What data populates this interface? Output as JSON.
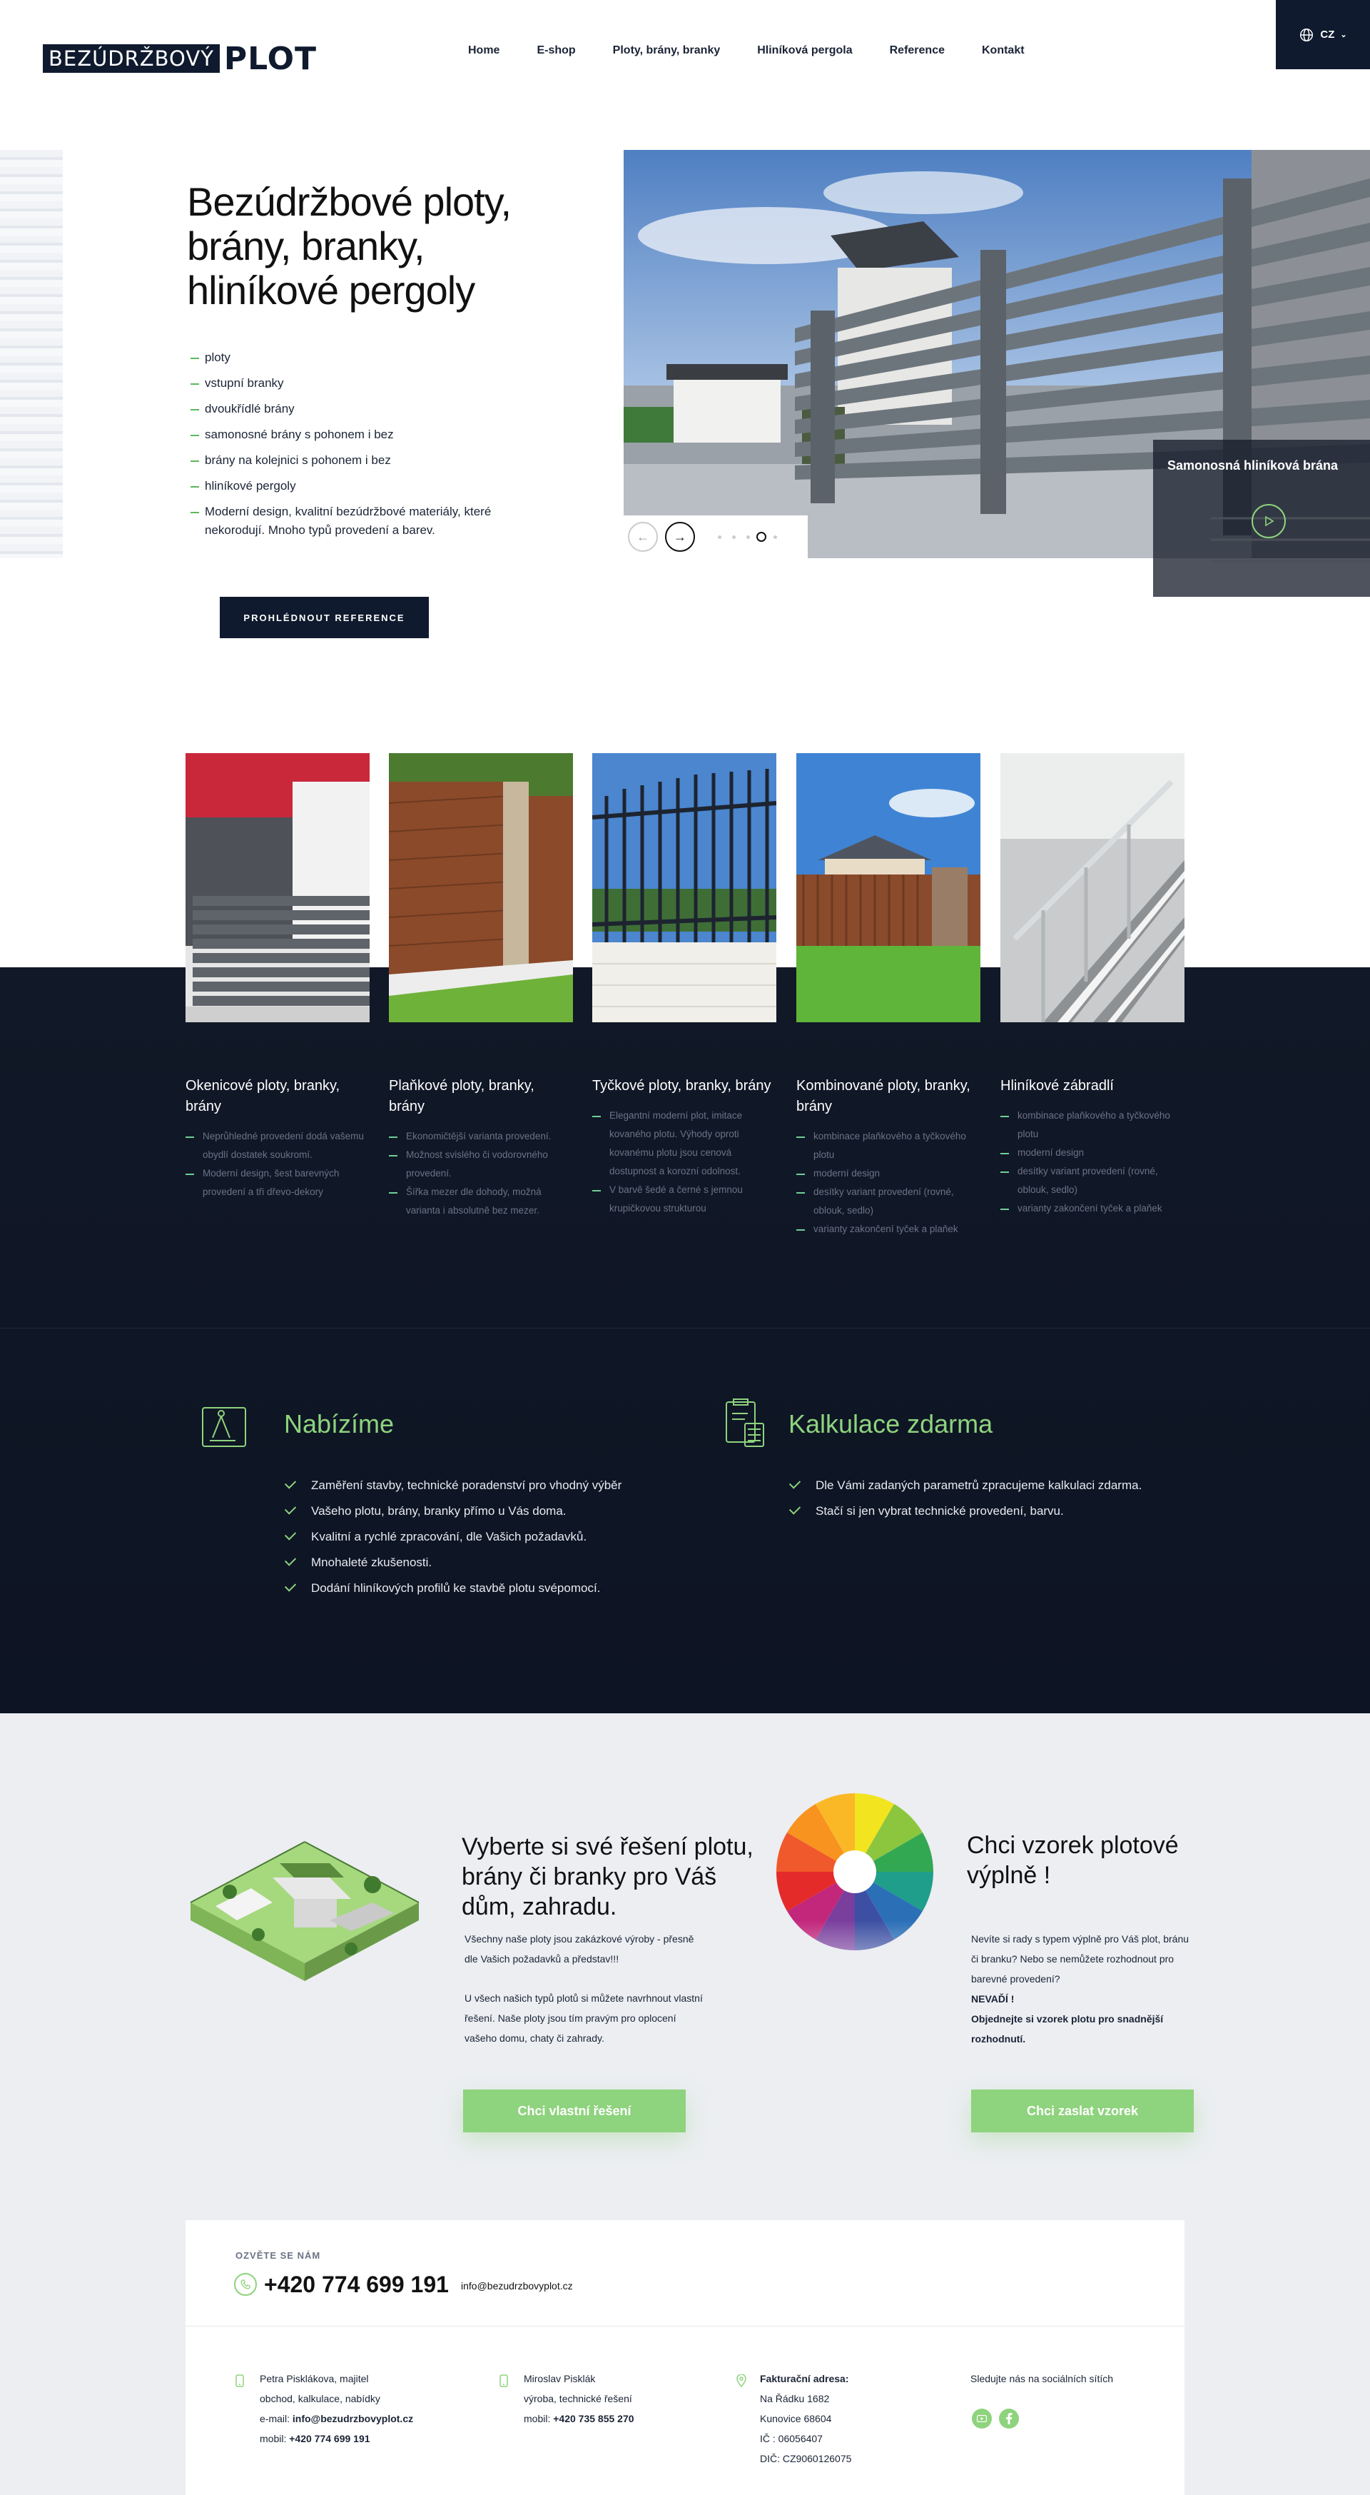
{
  "header": {
    "logo_box": "BEZÚDRŽBOVÝ",
    "logo_word": "PLOT",
    "nav": [
      "Home",
      "E-shop",
      "Ploty, brány, branky",
      "Hliníková pergola",
      "Reference",
      "Kontakt"
    ],
    "lang": "CZ"
  },
  "hero": {
    "title": "Bezúdržbové ploty, brány, branky, hliníkové pergoly",
    "list": [
      "ploty",
      "vstupní branky",
      "dvoukřídlé brány",
      "samonosné brány s pohonem i bez",
      "brány na kolejnici s pohonem i bez",
      "hliníkové pergoly",
      "Moderní design, kvalitní bezúdržbové materiály, které nekorodují. Mnoho typů provedení a barev."
    ],
    "button": "PROHLÉDNOUT REFERENCE",
    "slide_caption": "Samonosná hliníková brána",
    "slider_prev": "←",
    "slider_next": "→"
  },
  "products": [
    {
      "title": "Okenicové ploty, branky, brány",
      "items": [
        "Neprůhledné provedení dodá vašemu obydlí dostatek soukromí.",
        "Moderní design, šest barevných provedení a tři dřevo-dekory"
      ]
    },
    {
      "title": "Plaňkové ploty, branky, brány",
      "items": [
        "Ekonomičtější varianta provedení.",
        "Možnost svislého či vodorovného provedení.",
        "Šířka mezer dle dohody, možná varianta i absolutně bez mezer."
      ]
    },
    {
      "title": "Tyčkové ploty, branky, brány",
      "items": [
        "Elegantní moderní plot, imitace kovaného plotu. Výhody oproti kovanému plotu jsou cenová dostupnost a korozní odolnost.",
        "V barvě šedé a černé s jemnou krupičkovou strukturou"
      ]
    },
    {
      "title": "Kombinované ploty, branky, brány",
      "items": [
        "kombinace plaňkového a tyčkového plotu",
        "moderní design",
        "desítky variant provedení (rovné, oblouk, sedlo)",
        "varianty zakončení tyček a plaňek"
      ]
    },
    {
      "title": "Hliníkové zábradlí",
      "items": [
        "kombinace plaňkového a tyčkového plotu",
        "moderní design",
        "desítky variant provedení (rovné, oblouk, sedlo)",
        "varianty zakončení tyček a plaňek"
      ]
    }
  ],
  "offer": {
    "title": "Nabízíme",
    "items": [
      "Zaměření stavby, technické poradenství pro vhodný výběr",
      "Vašeho plotu, brány, branky přímo u Vás doma.",
      "Kvalitní a rychlé zpracování, dle Vašich požadavků.",
      "Mnohaleté zkušenosti.",
      "Dodání hliníkových profilů ke stavbě plotu svépomocí."
    ]
  },
  "calc": {
    "title": "Kalkulace zdarma",
    "items": [
      "Dle Vámi zadaných parametrů zpracujeme kalkulaci zdarma.",
      "Stačí si jen vybrat technické provedení, barvu."
    ]
  },
  "solution": {
    "title": "Vyberte si své řešení plotu, brány či branky pro Váš dům, zahradu.",
    "p1": "Všechny naše ploty jsou zakázkové výroby - přesně dle Vašich požadavků a představ!!!",
    "p2": "U všech našich typů plotů si můžete navrhnout vlastní řešení. Naše ploty jsou tím pravým pro oplocení vašeho domu, chaty či zahrady.",
    "button": "Chci vlastní řešení"
  },
  "sample": {
    "title": "Chci vzorek plotové výplně !",
    "p1": "Nevíte si rady s typem výplně pro Váš plot, bránu či branku? Nebo se nemůžete rozhodnout pro barevné provedení?",
    "p2": "NEVAĎÍ !",
    "p3": "Objednejte si vzorek plotu pro snadnější rozhodnutí.",
    "button": "Chci zaslat vzorek"
  },
  "contact": {
    "label": "OZVĚTE SE NÁM",
    "phone": "+420 774 699 191",
    "email": "info@bezudrzbovyplot.cz",
    "person1": {
      "name": "Petra Pisklákova, majitel",
      "role": "obchod, kalkulace, nabídky",
      "email_label": "e-mail:",
      "email": "info@bezudrzbovyplot.cz",
      "mobile_label": "mobil:",
      "mobile": "+420 774 699 191"
    },
    "person2": {
      "name": "Miroslav Pisklák",
      "role": "výroba, technické řešení",
      "mobile_label": "mobil:",
      "mobile": "+420 735 855 270"
    },
    "billing": {
      "title": "Fakturační adresa:",
      "street": "Na Řádku 1682",
      "city": "Kunovice 68604",
      "ic": "IČ : 06056407",
      "dic": "DIČ: CZ9060126075"
    },
    "social_label": "Sledujte nás na sociálních sítích"
  },
  "colors": {
    "navy": "#0f1a2e",
    "green": "#8ed37d",
    "light_bg": "#eceef2"
  }
}
